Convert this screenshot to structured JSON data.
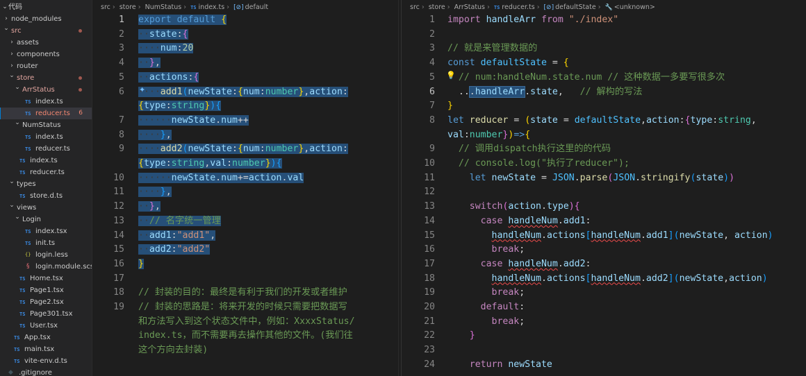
{
  "explorer": {
    "root_label": "代码",
    "items": [
      {
        "label": "node_modules",
        "type": "folder",
        "open": false,
        "indent": 0
      },
      {
        "label": "src",
        "type": "folder",
        "open": true,
        "indent": 0,
        "status": "modified"
      },
      {
        "label": "assets",
        "type": "folder",
        "open": false,
        "indent": 1
      },
      {
        "label": "components",
        "type": "folder",
        "open": false,
        "indent": 1
      },
      {
        "label": "router",
        "type": "folder",
        "open": false,
        "indent": 1
      },
      {
        "label": "store",
        "type": "folder",
        "open": true,
        "indent": 1,
        "status": "modified"
      },
      {
        "label": "ArrStatus",
        "type": "folder",
        "open": true,
        "indent": 2,
        "status": "modified"
      },
      {
        "label": "index.ts",
        "type": "ts",
        "indent": 3
      },
      {
        "label": "reducer.ts",
        "type": "ts",
        "indent": 3,
        "status": "error",
        "badge": "6",
        "selected": true
      },
      {
        "label": "NumStatus",
        "type": "folder",
        "open": true,
        "indent": 2
      },
      {
        "label": "index.ts",
        "type": "ts",
        "indent": 3
      },
      {
        "label": "reducer.ts",
        "type": "ts",
        "indent": 3
      },
      {
        "label": "index.ts",
        "type": "ts",
        "indent": 2
      },
      {
        "label": "reducer.ts",
        "type": "ts",
        "indent": 2
      },
      {
        "label": "types",
        "type": "folder",
        "open": true,
        "indent": 1
      },
      {
        "label": "store.d.ts",
        "type": "ts",
        "indent": 2
      },
      {
        "label": "views",
        "type": "folder",
        "open": true,
        "indent": 1
      },
      {
        "label": "Login",
        "type": "folder",
        "open": true,
        "indent": 2
      },
      {
        "label": "index.tsx",
        "type": "ts",
        "indent": 3
      },
      {
        "label": "init.ts",
        "type": "ts",
        "indent": 3
      },
      {
        "label": "login.less",
        "type": "less",
        "indent": 3
      },
      {
        "label": "login.module.scss",
        "type": "scss",
        "indent": 3
      },
      {
        "label": "Home.tsx",
        "type": "ts",
        "indent": 2
      },
      {
        "label": "Page1.tsx",
        "type": "ts",
        "indent": 2
      },
      {
        "label": "Page2.tsx",
        "type": "ts",
        "indent": 2
      },
      {
        "label": "Page301.tsx",
        "type": "ts",
        "indent": 2
      },
      {
        "label": "User.tsx",
        "type": "ts",
        "indent": 2
      },
      {
        "label": "App.tsx",
        "type": "ts",
        "indent": 1
      },
      {
        "label": "main.tsx",
        "type": "ts",
        "indent": 1
      },
      {
        "label": "vite-env.d.ts",
        "type": "ts",
        "indent": 1
      },
      {
        "label": ".gitignore",
        "type": "git",
        "indent": 0
      }
    ]
  },
  "left_editor": {
    "breadcrumb": [
      "src",
      "store",
      "NumStatus",
      "index.ts",
      "default"
    ],
    "lines": [
      {
        "n": "1",
        "html": "<span class=\"selbg\"><span class=\"kw\">export</span> <span class=\"kw\">default</span> <span class=\"br1\">{</span></span>"
      },
      {
        "n": "2",
        "html": "<span class=\"selbg\"><span class=\"ws\">··</span><span class=\"var\">state</span><span class=\"pun\">:</span><span class=\"br2\">{</span></span>"
      },
      {
        "n": "3",
        "html": "<span class=\"selbg\"><span class=\"ws\">····</span><span class=\"var\">num</span><span class=\"pun\">:</span><span class=\"num\">20</span></span>"
      },
      {
        "n": "4",
        "html": "<span class=\"selbg\"><span class=\"ws\">··</span><span class=\"br2\">}</span><span class=\"pun\">,</span></span>"
      },
      {
        "n": "5",
        "html": "<span class=\"selbg\"><span class=\"ws\">··</span><span class=\"var\">actions</span><span class=\"pun\">:</span><span class=\"br2\">{</span></span>"
      },
      {
        "n": "6",
        "html": "<span class=\"selbg\"><span class=\"ws\">····</span><span class=\"fn\">add1</span><span class=\"br3\">(</span><span class=\"var\">newState</span><span class=\"pun\">:</span><span class=\"br1\">{</span><span class=\"var\">num</span><span class=\"pun\">:</span><span class=\"ty\">number</span><span class=\"br1\">}</span><span class=\"pun\">,</span><span class=\"var\">action</span><span class=\"pun\">:</span></span>"
      },
      {
        "n": "",
        "html": "<span class=\"selbg\"><span class=\"br1\">{</span><span class=\"var\">type</span><span class=\"pun\">:</span><span class=\"ty\">string</span><span class=\"br1\">}</span><span class=\"br3\">)</span><span class=\"br3\">{</span></span>"
      },
      {
        "n": "7",
        "html": "<span class=\"selbg\"><span class=\"ws\">······</span><span class=\"var\">newState</span><span class=\"pun\">.</span><span class=\"var\">num</span><span class=\"pun\">++</span></span>"
      },
      {
        "n": "8",
        "html": "<span class=\"selbg\"><span class=\"ws\">····</span><span class=\"br3\">}</span><span class=\"pun\">,</span></span>"
      },
      {
        "n": "9",
        "html": "<span class=\"selbg\"><span class=\"ws\">····</span><span class=\"fn\">add2</span><span class=\"br3\">(</span><span class=\"var\">newState</span><span class=\"pun\">:</span><span class=\"br1\">{</span><span class=\"var\">num</span><span class=\"pun\">:</span><span class=\"ty\">number</span><span class=\"br1\">}</span><span class=\"pun\">,</span><span class=\"var\">action</span><span class=\"pun\">:</span></span>"
      },
      {
        "n": "",
        "html": "<span class=\"selbg\"><span class=\"br1\">{</span><span class=\"var\">type</span><span class=\"pun\">:</span><span class=\"ty\">string</span><span class=\"pun\">,</span><span class=\"var\">val</span><span class=\"pun\">:</span><span class=\"ty\">number</span><span class=\"br1\">}</span><span class=\"br3\">)</span><span class=\"br3\">{</span></span>"
      },
      {
        "n": "10",
        "html": "<span class=\"selbg\"><span class=\"ws\">······</span><span class=\"var\">newState</span><span class=\"pun\">.</span><span class=\"var\">num</span><span class=\"pun\">+=</span><span class=\"var\">action</span><span class=\"pun\">.</span><span class=\"var\">val</span></span>"
      },
      {
        "n": "11",
        "html": "<span class=\"selbg\"><span class=\"ws\">····</span><span class=\"br3\">}</span><span class=\"pun\">,</span></span>"
      },
      {
        "n": "12",
        "html": "<span class=\"selbg\"><span class=\"ws\">··</span><span class=\"br2\">}</span><span class=\"pun\">,</span></span>"
      },
      {
        "n": "13",
        "html": "<span class=\"selbg\"><span class=\"ws\">··</span><span class=\"cm\">// 名字统一管理</span></span>"
      },
      {
        "n": "14",
        "html": "<span class=\"selbg\"><span class=\"ws\">··</span><span class=\"var\">add1</span><span class=\"pun\">:</span><span class=\"str\">\"add1\"</span><span class=\"pun\">,</span></span>"
      },
      {
        "n": "15",
        "html": "<span class=\"selbg\"><span class=\"ws\">··</span><span class=\"var\">add2</span><span class=\"pun\">:</span><span class=\"str\">\"add2\"</span></span>"
      },
      {
        "n": "16",
        "html": "<span class=\"selbg\"><span class=\"br1\">}</span></span>"
      },
      {
        "n": "17",
        "html": ""
      },
      {
        "n": "18",
        "html": "<span class=\"cm\">// 封装的目的：最终是有利于我们的开发或者维护</span>"
      },
      {
        "n": "19",
        "html": "<span class=\"cm\">// 封装的思路是：将来开发的时候只需要把数据写</span>"
      },
      {
        "n": "",
        "html": "<span class=\"cm\">和方法写入到这个状态文件中，例如：XxxxStatus/</span>"
      },
      {
        "n": "",
        "html": "<span class=\"cm\">index.ts，而不需要再去操作其他的文件。(我们往</span>"
      },
      {
        "n": "",
        "html": "<span class=\"cm\">这个方向去封装)</span>"
      }
    ]
  },
  "right_editor": {
    "breadcrumb": [
      "src",
      "store",
      "ArrStatus",
      "reducer.ts",
      "defaultState",
      "<unknown>"
    ],
    "lines": [
      {
        "n": "1",
        "html": "<span class=\"ctrl\">import</span> <span class=\"var\">handleArr</span> <span class=\"ctrl\">from</span> <span class=\"str\">\"./index\"</span>"
      },
      {
        "n": "2",
        "html": ""
      },
      {
        "n": "3",
        "html": "<span class=\"cm\">// 就是来管理数据的</span>"
      },
      {
        "n": "4",
        "html": "<span class=\"kw\">const</span> <span class=\"cst\">defaultState</span> <span class=\"pun\">=</span> <span class=\"br1\">{</span>"
      },
      {
        "n": "5",
        "html": "  <span class=\"cm\">// num:handleNum.state.num // 这种数据一多要写很多次</span>"
      },
      {
        "n": "6",
        "html": "  <span class=\"pun\">..</span><span class=\"hl-word\"><span class=\"pun\">.</span><span class=\"var\">handleArr</span></span><span class=\"pun\">.</span><span class=\"var\">state</span><span class=\"pun\">,</span>   <span class=\"cm\">// 解构的写法</span>"
      },
      {
        "n": "7",
        "html": "<span class=\"br1\">}</span>"
      },
      {
        "n": "8",
        "html": "<span class=\"kw\">let</span> <span class=\"fn\">reducer</span> <span class=\"pun\">=</span> <span class=\"br1\">(</span><span class=\"var\">state</span> <span class=\"pun\">=</span> <span class=\"cst\">defaultState</span><span class=\"pun\">,</span><span class=\"var\">action</span><span class=\"pun\">:</span><span class=\"br2\">{</span><span class=\"var\">type</span><span class=\"pun\">:</span><span class=\"ty\">string</span><span class=\"pun\">,</span>"
      },
      {
        "n": "",
        "html": "<span class=\"var\">val</span><span class=\"pun\">:</span><span class=\"ty\">number</span><span class=\"br2\">}</span><span class=\"br1\">)</span><span class=\"kw\">=&gt;</span><span class=\"br1\">{</span>"
      },
      {
        "n": "9",
        "html": "  <span class=\"cm\">// 调用dispatch执行这里的的代码</span>"
      },
      {
        "n": "10",
        "html": "  <span class=\"cm\">// console.log(\"执行了reducer\");</span>"
      },
      {
        "n": "11",
        "html": "    <span class=\"kw\">let</span> <span class=\"var\">newState</span> <span class=\"pun\">=</span> <span class=\"cst\">JSON</span><span class=\"pun\">.</span><span class=\"fn\">parse</span><span class=\"br2\">(</span><span class=\"cst\">JSON</span><span class=\"pun\">.</span><span class=\"fn\">stringify</span><span class=\"br3\">(</span><span class=\"var\">state</span><span class=\"br3\">)</span><span class=\"br2\">)</span>"
      },
      {
        "n": "12",
        "html": ""
      },
      {
        "n": "13",
        "html": "    <span class=\"ctrl\">switch</span><span class=\"br2\">(</span><span class=\"var\">action</span><span class=\"pun\">.</span><span class=\"var\">type</span><span class=\"br2\">)</span><span class=\"br2\">{</span>"
      },
      {
        "n": "14",
        "html": "      <span class=\"ctrl\">case</span> <span class=\"var sq\">handleNum</span><span class=\"pun\">.</span><span class=\"var\">add1</span><span class=\"pun\">:</span>"
      },
      {
        "n": "15",
        "html": "        <span class=\"var sq\">handleNum</span><span class=\"pun\">.</span><span class=\"var\">actions</span><span class=\"br3\">[</span><span class=\"var sq\">handleNum</span><span class=\"pun\">.</span><span class=\"var\">add1</span><span class=\"br3\">]</span><span class=\"br3\">(</span><span class=\"var\">newState</span><span class=\"pun\">,</span> <span class=\"var\">action</span><span class=\"br3\">)</span>"
      },
      {
        "n": "16",
        "html": "        <span class=\"ctrl\">break</span><span class=\"pun\">;</span>"
      },
      {
        "n": "17",
        "html": "      <span class=\"ctrl\">case</span> <span class=\"var sq\">handleNum</span><span class=\"pun\">.</span><span class=\"var\">add2</span><span class=\"pun\">:</span>"
      },
      {
        "n": "18",
        "html": "        <span class=\"var sq\">handleNum</span><span class=\"pun\">.</span><span class=\"var\">actions</span><span class=\"br3\">[</span><span class=\"var sq\">handleNum</span><span class=\"pun\">.</span><span class=\"var\">add2</span><span class=\"br3\">]</span><span class=\"br3\">(</span><span class=\"var\">newState</span><span class=\"pun\">,</span><span class=\"var\">action</span><span class=\"br3\">)</span>"
      },
      {
        "n": "19",
        "html": "        <span class=\"ctrl\">break</span><span class=\"pun\">;</span>"
      },
      {
        "n": "20",
        "html": "      <span class=\"ctrl\">default</span><span class=\"pun\">:</span>"
      },
      {
        "n": "21",
        "html": "        <span class=\"ctrl\">break</span><span class=\"pun\">;</span>"
      },
      {
        "n": "22",
        "html": "    <span class=\"br2\">}</span>"
      },
      {
        "n": "23",
        "html": ""
      },
      {
        "n": "24",
        "html": "    <span class=\"ctrl\">return</span> <span class=\"var\">newState</span>"
      }
    ]
  },
  "icons": {
    "left_line6": "lightbulb-autofix-icon",
    "right_line5": "lightbulb-icon",
    "breadcrumb_symbol": "symbol-variable-icon",
    "breadcrumb_wrench": "wrench-icon"
  },
  "colors": {
    "background": "#1e1e1e",
    "sidebar": "#252526",
    "selection": "#264f78",
    "accent": "#007fd4"
  }
}
